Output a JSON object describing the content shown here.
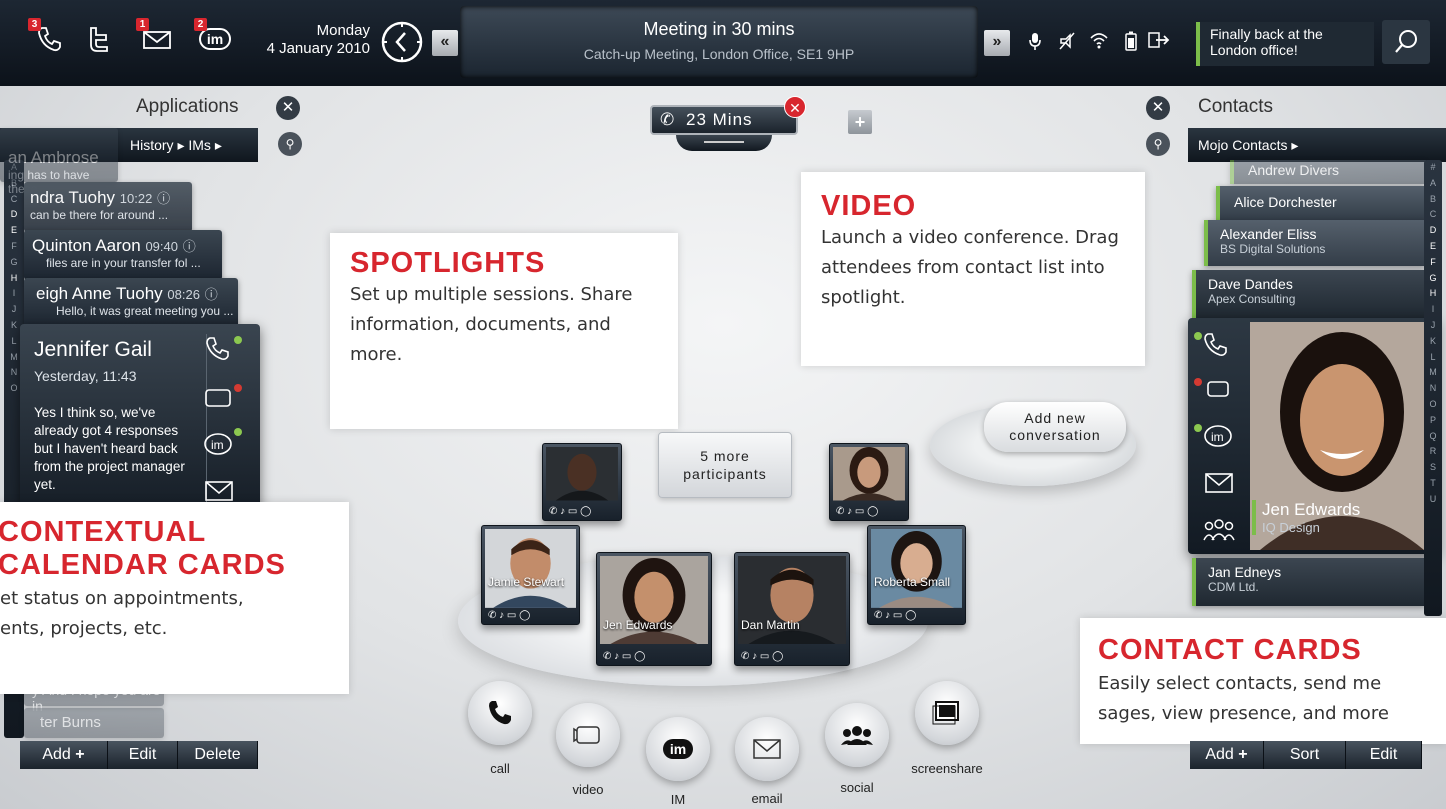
{
  "topbar": {
    "phone_badge": "3",
    "mail_badge": "1",
    "im_badge": "2",
    "im_text": "im",
    "day": "Monday",
    "date": "4 January 2010",
    "nav_prev": "«",
    "nav_next": "»",
    "meeting_title": "Meeting in 30 mins",
    "meeting_detail": "Catch-up Meeting, London Office, SE1 9HP",
    "status_message": "Finally back at the London office!",
    "accent_color": "#7cbd4a"
  },
  "applications": {
    "title": "Applications",
    "breadcrumb": [
      "History",
      "IMs"
    ],
    "alphabet": [
      "A",
      "B",
      "C",
      "D",
      "E",
      "F",
      "G",
      "H",
      "I",
      "J",
      "K",
      "L",
      "M",
      "N",
      "O"
    ],
    "history": [
      {
        "name": "an Ambrose",
        "preview": "ing has to have these ..."
      },
      {
        "name": "ndra Tuohy",
        "time": "10:22",
        "preview": "can be there for around ..."
      },
      {
        "name": "Quinton Aaron",
        "time": "09:40",
        "preview": "files are in your transfer fol ..."
      },
      {
        "name": "eigh Anne Tuohy",
        "time": "08:26",
        "preview": "Hello, it was great meeting you ..."
      }
    ],
    "bottom_items": [
      {
        "name": "y And I hope you are in"
      },
      {
        "name": "ter Burns"
      }
    ],
    "active_chat": {
      "name": "Jennifer Gail",
      "time": "Yesterday, 11:43",
      "message": "Yes I think so, we've already got 4 responses but I haven't heard back from the project manager yet."
    },
    "buttons": [
      "Add",
      "Edit",
      "Delete"
    ]
  },
  "call_timer": {
    "label": "23 Mins"
  },
  "plus_label": "+",
  "callouts": {
    "spotlights": {
      "title": "SPOTLIGHTS",
      "text": "Set up multiple sessions. Share information, documents, and more."
    },
    "video": {
      "title": "VIDEO",
      "text": "Launch a video conference. Drag attendees from contact list into spotlight."
    },
    "calendar": {
      "title_1": "CONTEXTUAL",
      "title_2": "CALENDAR CARDS",
      "text_1": "et status on appointments,",
      "text_2": "ents, projects, etc."
    },
    "contact_cards": {
      "title": "CONTACT CARDS",
      "text_1": "Easily select contacts, send me",
      "text_2": "sages, view presence, and more"
    }
  },
  "add_conversation": "Add new conversation",
  "more_participants": "5 more participants",
  "participants": [
    {
      "name": ""
    },
    {
      "name": ""
    },
    {
      "name": "Jamie Stewart"
    },
    {
      "name": "Jen Edwards"
    },
    {
      "name": "Dan Martin"
    },
    {
      "name": "Roberta Small"
    }
  ],
  "actions": [
    {
      "label": "call",
      "icon": "phone-icon"
    },
    {
      "label": "video",
      "icon": "video-icon"
    },
    {
      "label": "IM",
      "icon": "im-icon"
    },
    {
      "label": "email",
      "icon": "email-icon"
    },
    {
      "label": "social",
      "icon": "social-icon"
    },
    {
      "label": "screenshare",
      "icon": "screenshare-icon"
    }
  ],
  "contacts": {
    "title": "Contacts",
    "breadcrumb": "Mojo Contacts",
    "alphabet": [
      "#",
      "A",
      "B",
      "C",
      "D",
      "E",
      "F",
      "G",
      "H",
      "I",
      "J",
      "K",
      "L",
      "M",
      "N",
      "O",
      "P",
      "Q",
      "R",
      "S",
      "T",
      "U"
    ],
    "list": [
      {
        "name": "Andrew Divers"
      },
      {
        "name": "Alice Dorchester"
      },
      {
        "name": "Alexander Eliss",
        "org": "BS Digital Solutions"
      },
      {
        "name": "Dave Dandes",
        "org": "Apex Consulting"
      },
      {
        "name": "Jan Edneys",
        "org": "CDM Ltd."
      }
    ],
    "selected": {
      "name": "Jen Edwards",
      "org": "IQ Design"
    },
    "buttons": [
      "Add",
      "Sort",
      "Edit"
    ]
  }
}
